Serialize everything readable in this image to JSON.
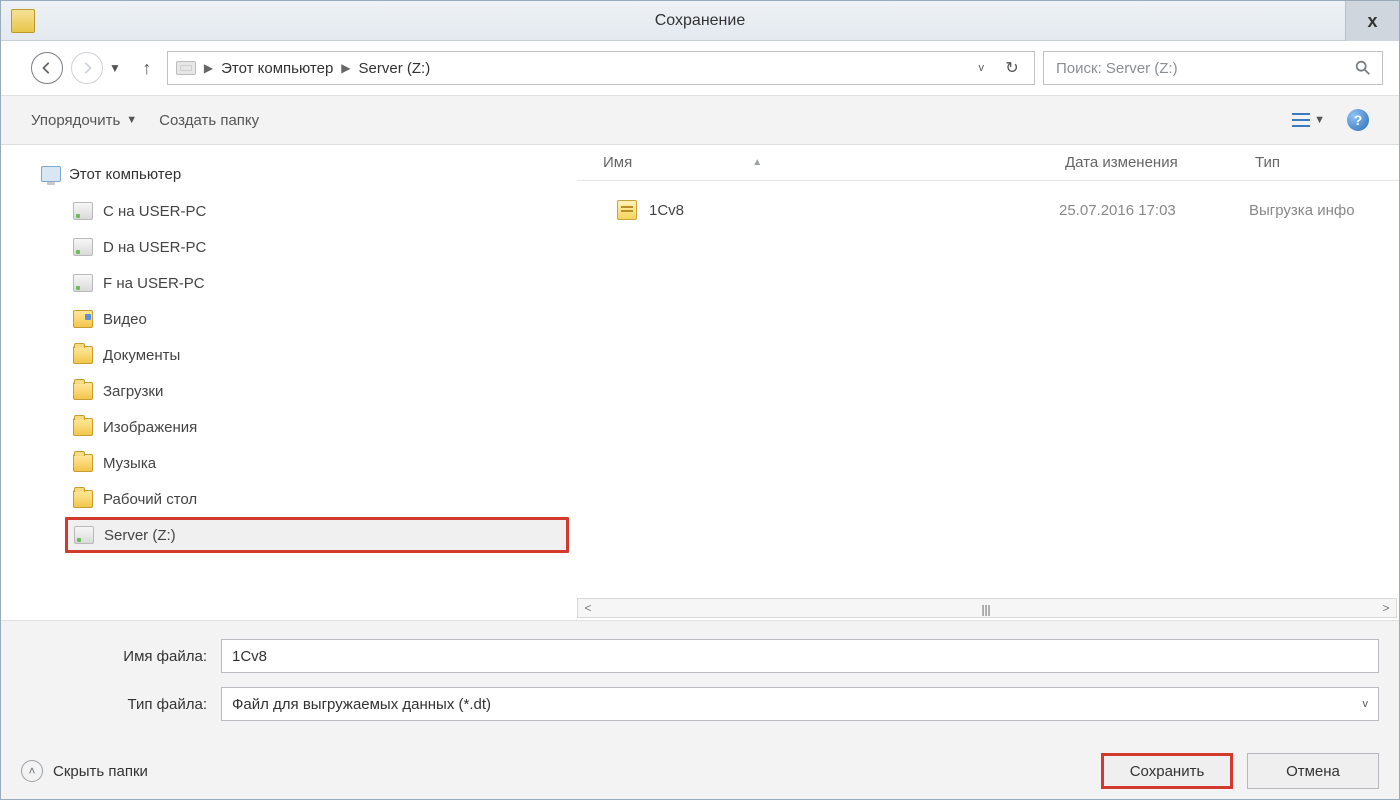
{
  "title": "Сохранение",
  "breadcrumb": {
    "root": "Этот компьютер",
    "leaf": "Server (Z:)"
  },
  "search": {
    "placeholder": "Поиск: Server (Z:)"
  },
  "toolbar": {
    "organize": "Упорядочить",
    "new_folder": "Создать папку"
  },
  "sidebar": {
    "root": "Этот компьютер",
    "items": [
      {
        "label": "C на USER-PC",
        "kind": "drive"
      },
      {
        "label": "D на USER-PC",
        "kind": "drive"
      },
      {
        "label": "F на USER-PC",
        "kind": "drive"
      },
      {
        "label": "Видео",
        "kind": "media"
      },
      {
        "label": "Документы",
        "kind": "folder"
      },
      {
        "label": "Загрузки",
        "kind": "folder"
      },
      {
        "label": "Изображения",
        "kind": "folder"
      },
      {
        "label": "Музыка",
        "kind": "folder"
      },
      {
        "label": "Рабочий стол",
        "kind": "folder"
      },
      {
        "label": "Server (Z:)",
        "kind": "drive",
        "selected": true,
        "highlighted": true
      }
    ]
  },
  "columns": {
    "name": "Имя",
    "date": "Дата изменения",
    "type": "Тип"
  },
  "files": [
    {
      "name": "1Cv8",
      "date": "25.07.2016 17:03",
      "type": "Выгрузка инфо"
    }
  ],
  "form": {
    "filename_label": "Имя файла:",
    "filename_value": "1Cv8",
    "filetype_label": "Тип файла:",
    "filetype_value": "Файл для выгружаемых данных (*.dt)"
  },
  "footer": {
    "hide_folders": "Скрыть папки",
    "save": "Сохранить",
    "cancel": "Отмена"
  }
}
